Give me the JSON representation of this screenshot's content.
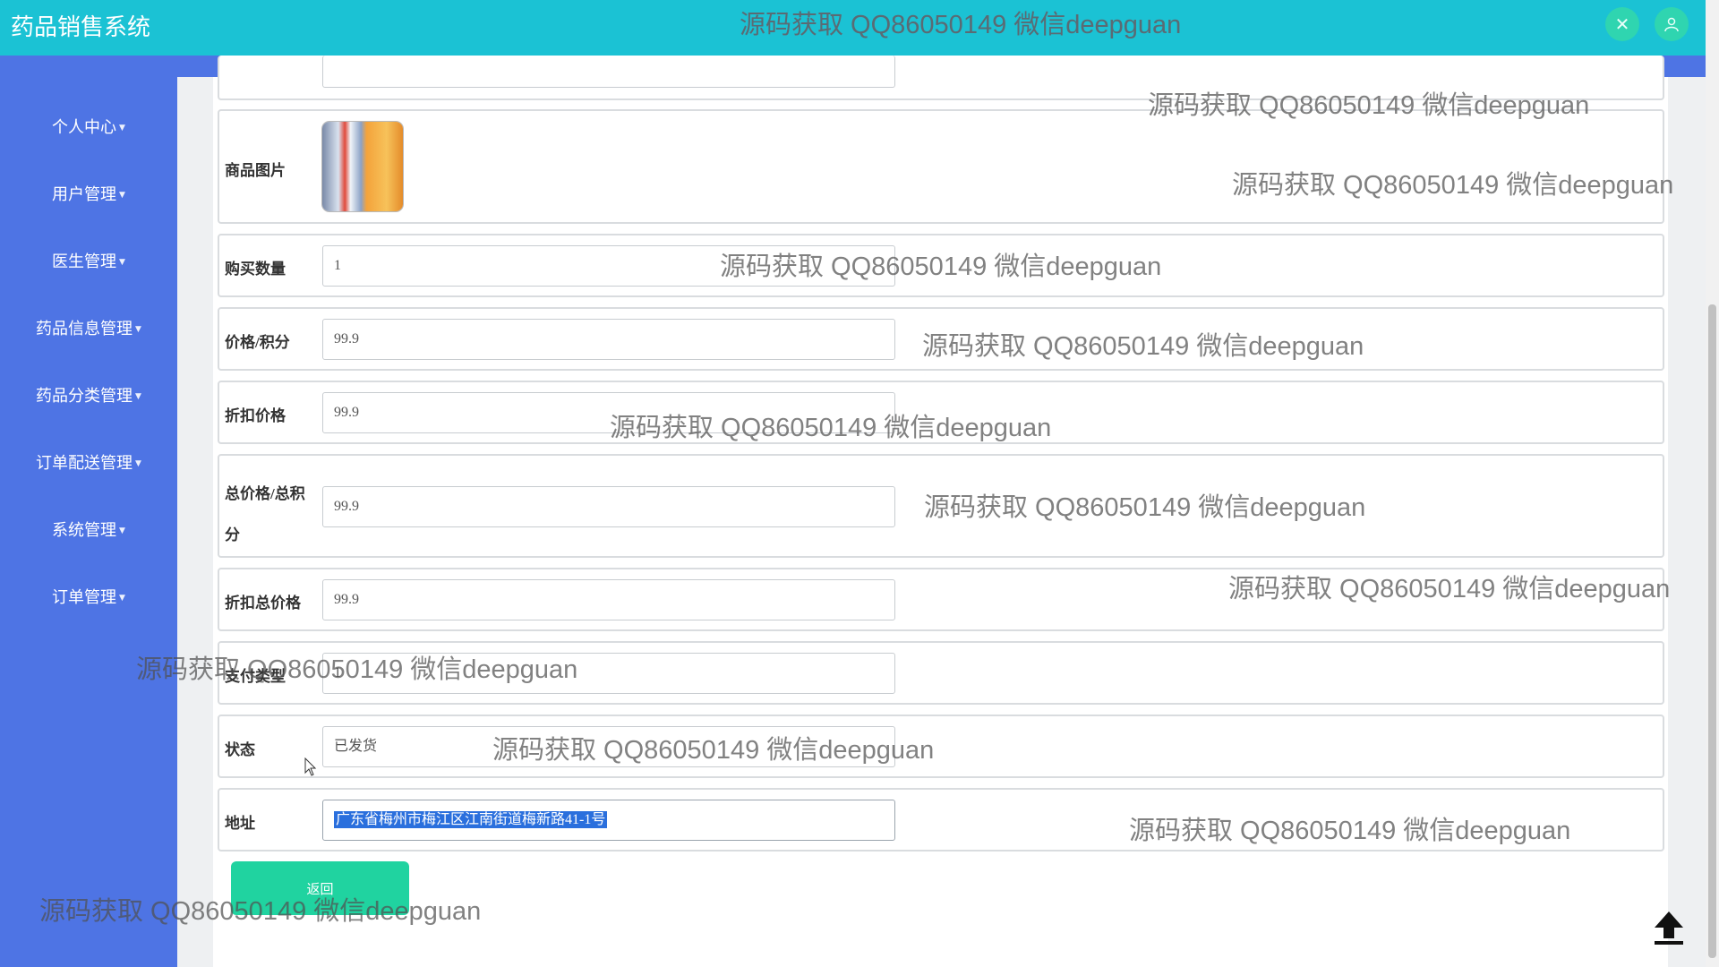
{
  "app": {
    "title": "药品销售系统"
  },
  "watermark": "源码获取 QQ86050149 微信deepguan",
  "header": {
    "close_icon": "close-icon",
    "user_icon": "user-icon"
  },
  "sidebar": {
    "items": [
      {
        "label": "个人中心"
      },
      {
        "label": "用户管理"
      },
      {
        "label": "医生管理"
      },
      {
        "label": "药品信息管理"
      },
      {
        "label": "药品分类管理"
      },
      {
        "label": "订单配送管理"
      },
      {
        "label": "系统管理"
      },
      {
        "label": "订单管理"
      }
    ]
  },
  "form": {
    "image_label": "商品图片",
    "quantity": {
      "label": "购买数量",
      "value": "1"
    },
    "price": {
      "label": "价格/积分",
      "value": "99.9"
    },
    "discount_price": {
      "label": "折扣价格",
      "value": "99.9"
    },
    "total_price": {
      "label_line1": "总价格/总积",
      "label_line2": "分",
      "value": "99.9"
    },
    "discount_total": {
      "label": "折扣总价格",
      "value": "99.9"
    },
    "pay_type": {
      "label": "支付类型",
      "value": "1"
    },
    "status": {
      "label": "状态",
      "value": "已发货"
    },
    "address": {
      "label": "地址",
      "value": "广东省梅州市梅江区江南街道梅新路41-1号"
    },
    "back_button": "返回"
  },
  "colors": {
    "header": "#1bc2d4",
    "sidebar": "#4e74e4",
    "button": "#20d3a0"
  }
}
